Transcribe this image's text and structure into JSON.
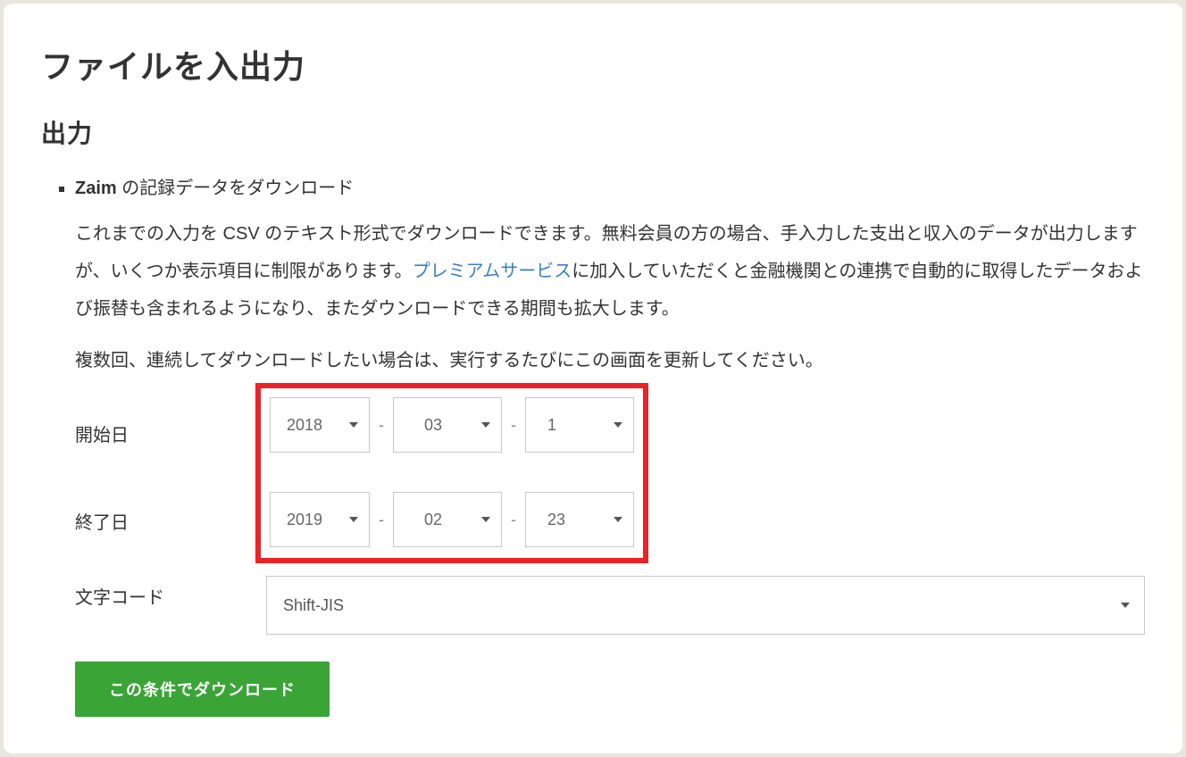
{
  "page": {
    "title": "ファイルを入出力",
    "section_title": "出力",
    "list_brand": "Zaim",
    "list_text": " の記録データをダウンロード",
    "desc_1a": "これまでの入力を CSV のテキスト形式でダウンロードできます。無料会員の方の場合、手入力した支出と収入のデータが出力しますが、いくつか表示項目に制限があります。",
    "premium_link": "プレミアムサービス",
    "desc_1b": "に加入していただくと金融機関との連携で自動的に取得したデータおよび振替も含まれるようになり、またダウンロードできる期間も拡大します。",
    "desc_2": "複数回、連続してダウンロードしたい場合は、実行するたびにこの画面を更新してください。"
  },
  "form": {
    "start_label": "開始日",
    "end_label": "終了日",
    "encoding_label": "文字コード",
    "start": {
      "year": "2018",
      "month": "03",
      "day": "1"
    },
    "end": {
      "year": "2019",
      "month": "02",
      "day": "23"
    },
    "encoding_value": "Shift-JIS",
    "download_button": "この条件でダウンロード"
  }
}
